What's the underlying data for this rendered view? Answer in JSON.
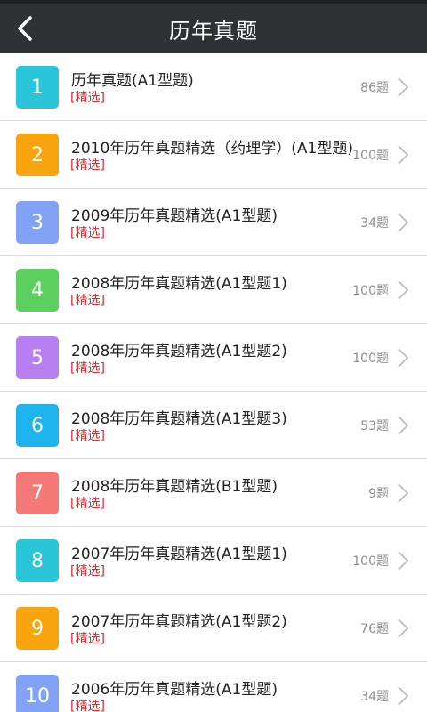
{
  "header": {
    "title": "历年真题",
    "back_icon": "chevron-left-icon"
  },
  "colors": {
    "header_bg": "#2f3234",
    "tag": "#e8242b",
    "count": "#8f8f8f"
  },
  "items": [
    {
      "number": "1",
      "title": "历年真题(A1型题)",
      "tag": "[精选]",
      "count": "86题",
      "color": "#2ac5d8"
    },
    {
      "number": "2",
      "title": "2010年历年真题精选（药理学）(A1型题)",
      "tag": "[精选]",
      "count": "100题",
      "color": "#f8a40e"
    },
    {
      "number": "3",
      "title": "2009年历年真题精选(A1型题)",
      "tag": "[精选]",
      "count": "34题",
      "color": "#82a3f5"
    },
    {
      "number": "4",
      "title": "2008年历年真题精选(A1型题1)",
      "tag": "[精选]",
      "count": "100题",
      "color": "#5bd05e"
    },
    {
      "number": "5",
      "title": "2008年历年真题精选(A1型题2)",
      "tag": "[精选]",
      "count": "100题",
      "color": "#b77ff2"
    },
    {
      "number": "6",
      "title": "2008年历年真题精选(A1型题3)",
      "tag": "[精选]",
      "count": "53题",
      "color": "#1fb3ee"
    },
    {
      "number": "7",
      "title": "2008年历年真题精选(B1型题)",
      "tag": "[精选]",
      "count": "9题",
      "color": "#f57a77"
    },
    {
      "number": "8",
      "title": "2007年历年真题精选(A1型题1)",
      "tag": "[精选]",
      "count": "100题",
      "color": "#2ac5d8"
    },
    {
      "number": "9",
      "title": "2007年历年真题精选(A1型题2)",
      "tag": "[精选]",
      "count": "76题",
      "color": "#f8a40e"
    },
    {
      "number": "10",
      "title": "2006年历年真题精选(A1型题)",
      "tag": "[精选]",
      "count": "34题",
      "color": "#82a3f5"
    }
  ]
}
